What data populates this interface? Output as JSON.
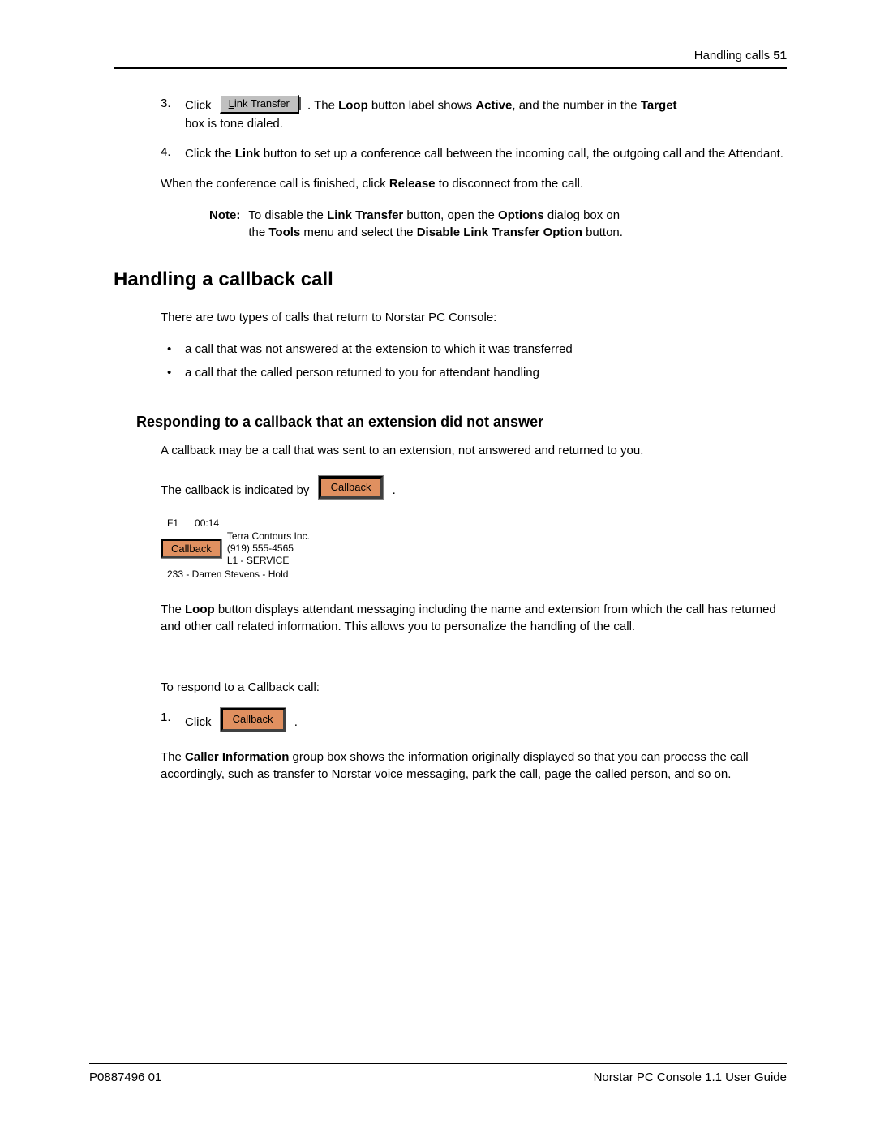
{
  "header": {
    "section": "Handling calls",
    "page_number": "51"
  },
  "steps_a": {
    "items": [
      {
        "marker": "3.",
        "pre": "Click",
        "button": {
          "accel": "L",
          "rest": "ink Transfer"
        },
        "post1": ". The ",
        "b1": "Loop",
        "mid1": " button label shows ",
        "b2": "Active",
        "mid2": ", and the number in the ",
        "b3": "Target",
        "line2": "box is tone dialed."
      },
      {
        "marker": "4.",
        "pre": "Click the ",
        "b1": "Link",
        "post": " button to set up a conference call between the incoming call, the outgoing call and the Attendant."
      }
    ],
    "after_para_pre": "When the conference call is finished, click ",
    "after_para_b": "Release",
    "after_para_post": " to disconnect from the call."
  },
  "note": {
    "label": "Note:",
    "t1": "To disable the ",
    "b1": "Link Transfer",
    "t2": " button, open the ",
    "b2": "Options",
    "t3": " dialog box on the ",
    "b3": "Tools",
    "t4": " menu and select the ",
    "b4": "Disable Link Transfer Option",
    "t5": " button."
  },
  "section_heading": "Handling a callback call",
  "intro_para": "There are two types of calls that return to Norstar PC Console:",
  "bullets": [
    "a call that was not answered at the extension to which it was transferred",
    "a call that the called person returned to you for attendant handling"
  ],
  "subsection_heading": "Responding to a callback that an extension did not answer",
  "sub_para1": "A callback may be a call that was sent to an extension, not answered and returned to you.",
  "indicated_line": {
    "pre": "The callback is indicated by ",
    "btn": "Callback",
    "post": "."
  },
  "loop_card": {
    "fkey": "F1",
    "timer": "00:14",
    "btn": "Callback",
    "company": "Terra Contours Inc.",
    "phone": "(919) 555-4565",
    "line": "L1 - SERVICE",
    "status": "233 - Darren Stevens - Hold"
  },
  "loop_para": {
    "t1": "The ",
    "b1": "Loop",
    "t2": " button displays attendant messaging including the name and extension from which the call has returned and other call related information. This allows you to personalize the handling of the call."
  },
  "respond_para": "To respond to a Callback call:",
  "steps_b": {
    "items": [
      {
        "marker": "1.",
        "pre": "Click",
        "btn": "Callback",
        "post": "."
      }
    ],
    "after": {
      "t1": "The ",
      "b1": "Caller Information",
      "t2": " group box shows the information originally displayed so that you can process the call accordingly, such as transfer to Norstar voice messaging, park the call, page the called person, and so on."
    }
  },
  "footer": {
    "left": "P0887496 01",
    "right": "Norstar PC Console 1.1 User Guide"
  }
}
